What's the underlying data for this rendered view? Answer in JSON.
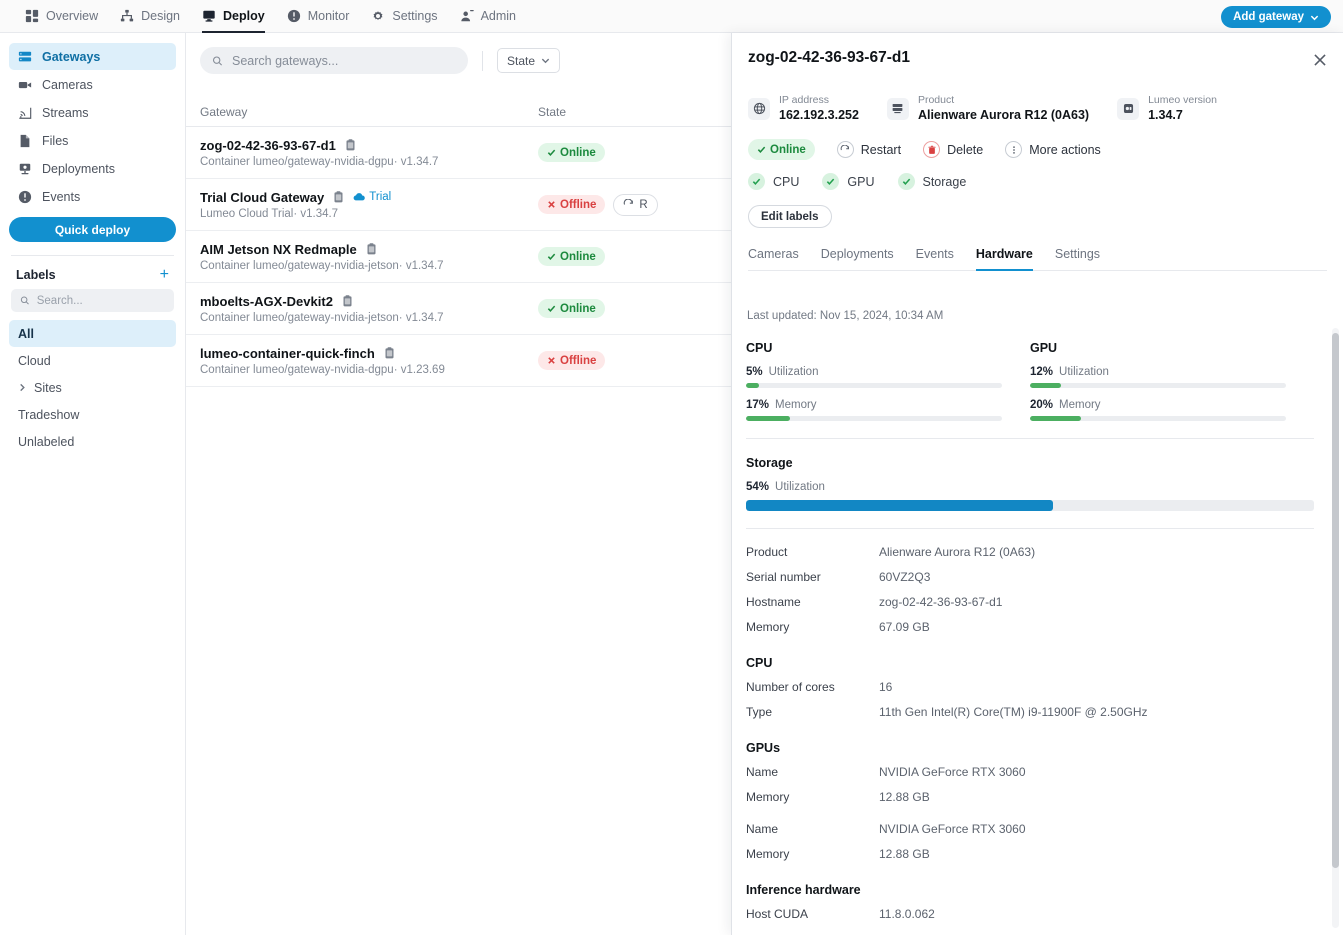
{
  "topnav": {
    "items": [
      {
        "label": "Overview",
        "icon": "grid-icon",
        "active": false
      },
      {
        "label": "Design",
        "icon": "sitemap-icon",
        "active": false
      },
      {
        "label": "Deploy",
        "icon": "monitor-icon",
        "active": true
      },
      {
        "label": "Monitor",
        "icon": "alert-icon",
        "active": false
      },
      {
        "label": "Settings",
        "icon": "gear-icon",
        "active": false
      },
      {
        "label": "Admin",
        "icon": "user-add-icon",
        "active": false
      }
    ],
    "add_gateway_label": "Add gateway"
  },
  "sidebar": {
    "items": [
      {
        "label": "Gateways",
        "icon": "server-icon",
        "active": true
      },
      {
        "label": "Cameras",
        "icon": "camera-icon",
        "active": false
      },
      {
        "label": "Streams",
        "icon": "stream-icon",
        "active": false
      },
      {
        "label": "Files",
        "icon": "file-icon",
        "active": false
      },
      {
        "label": "Deployments",
        "icon": "deployment-icon",
        "active": false
      },
      {
        "label": "Events",
        "icon": "alert-icon",
        "active": false
      }
    ],
    "quick_deploy_label": "Quick deploy",
    "labels_title": "Labels",
    "add_label_icon": "plus-icon",
    "search_placeholder": "Search...",
    "search_value": "",
    "labels": [
      {
        "label": "All",
        "active": true,
        "expandable": false
      },
      {
        "label": "Cloud",
        "active": false,
        "expandable": false
      },
      {
        "label": "Sites",
        "active": false,
        "expandable": true
      },
      {
        "label": "Tradeshow",
        "active": false,
        "expandable": false
      },
      {
        "label": "Unlabeled",
        "active": false,
        "expandable": false
      }
    ]
  },
  "list": {
    "search_placeholder": "Search gateways...",
    "search_value": "",
    "state_filter_label": "State",
    "columns": {
      "gateway": "Gateway",
      "state": "State"
    },
    "rows": [
      {
        "name": "zog-02-42-36-93-67-d1",
        "subtitle": "Container lumeo/gateway-nvidia-dgpu· v1.34.7",
        "state": "Online",
        "state_kind": "online",
        "trial": false,
        "restart_label": ""
      },
      {
        "name": "Trial Cloud Gateway",
        "subtitle": "Lumeo Cloud Trial· v1.34.7",
        "state": "Offline",
        "state_kind": "offline",
        "trial": true,
        "trial_label": "Trial",
        "restart_label": "R"
      },
      {
        "name": "AIM Jetson NX Redmaple",
        "subtitle": "Container lumeo/gateway-nvidia-jetson· v1.34.7",
        "state": "Online",
        "state_kind": "online",
        "trial": false,
        "restart_label": ""
      },
      {
        "name": "mboelts-AGX-Devkit2",
        "subtitle": "Container lumeo/gateway-nvidia-jetson· v1.34.7",
        "state": "Online",
        "state_kind": "online",
        "trial": false,
        "restart_label": ""
      },
      {
        "name": "lumeo-container-quick-finch",
        "subtitle": "Container lumeo/gateway-nvidia-dgpu· v1.23.69",
        "state": "Offline",
        "state_kind": "offline",
        "trial": false,
        "restart_label": ""
      }
    ]
  },
  "detail": {
    "title": "zog-02-42-36-93-67-d1",
    "close_icon": "close-icon",
    "meta": [
      {
        "icon": "globe-icon",
        "label": "IP address",
        "value": "162.192.3.252"
      },
      {
        "icon": "server-icon",
        "label": "Product",
        "value": "Alienware Aurora R12 (0A63)"
      },
      {
        "icon": "chip-icon",
        "label": "Lumeo version",
        "value": "1.34.7"
      }
    ],
    "status_pill": "Online",
    "actions": [
      {
        "label": "Restart",
        "icon": "refresh-icon",
        "danger": false
      },
      {
        "label": "Delete",
        "icon": "trash-icon",
        "danger": true
      },
      {
        "label": "More actions",
        "icon": "dots-vertical-icon",
        "danger": false
      }
    ],
    "health": [
      {
        "label": "CPU",
        "ok": true
      },
      {
        "label": "GPU",
        "ok": true
      },
      {
        "label": "Storage",
        "ok": true
      }
    ],
    "edit_labels_label": "Edit labels",
    "tabs": [
      {
        "label": "Cameras",
        "active": false
      },
      {
        "label": "Deployments",
        "active": false
      },
      {
        "label": "Events",
        "active": false
      },
      {
        "label": "Hardware",
        "active": true
      },
      {
        "label": "Settings",
        "active": false
      }
    ],
    "last_updated": "Last updated: Nov 15, 2024, 10:34 AM",
    "metrics": {
      "cpu": {
        "title": "CPU",
        "utilization_pct": "5%",
        "utilization_label": "Utilization",
        "utilization_value": 5,
        "memory_pct": "17%",
        "memory_label": "Memory",
        "memory_value": 17
      },
      "gpu": {
        "title": "GPU",
        "utilization_pct": "12%",
        "utilization_label": "Utilization",
        "utilization_value": 12,
        "memory_pct": "20%",
        "memory_label": "Memory",
        "memory_value": 20
      },
      "storage": {
        "title": "Storage",
        "utilization_pct": "54%",
        "utilization_label": "Utilization",
        "utilization_value": 54
      }
    },
    "system": {
      "product_k": "Product",
      "product_v": "Alienware Aurora R12 (0A63)",
      "serial_k": "Serial number",
      "serial_v": "60VZ2Q3",
      "hostname_k": "Hostname",
      "hostname_v": "zog-02-42-36-93-67-d1",
      "memory_k": "Memory",
      "memory_v": "67.09 GB"
    },
    "cpu_section": {
      "title": "CPU",
      "cores_k": "Number of cores",
      "cores_v": "16",
      "type_k": "Type",
      "type_v": "11th Gen Intel(R) Core(TM) i9-11900F @ 2.50GHz"
    },
    "gpu_section": {
      "title": "GPUs",
      "gpu1_name_k": "Name",
      "gpu1_name_v": "NVIDIA GeForce RTX 3060",
      "gpu1_mem_k": "Memory",
      "gpu1_mem_v": "12.88 GB",
      "gpu2_name_k": "Name",
      "gpu2_name_v": "NVIDIA GeForce RTX 3060",
      "gpu2_mem_k": "Memory",
      "gpu2_mem_v": "12.88 GB"
    },
    "inference_section": {
      "title": "Inference hardware",
      "cuda_k": "Host CUDA",
      "cuda_v": "11.8.0.062"
    }
  },
  "colors": {
    "accent": "#1290cf",
    "online": "#1c8a3e",
    "offline": "#d94141",
    "bar_green": "#4caf61",
    "bar_blue": "#1287c4"
  }
}
